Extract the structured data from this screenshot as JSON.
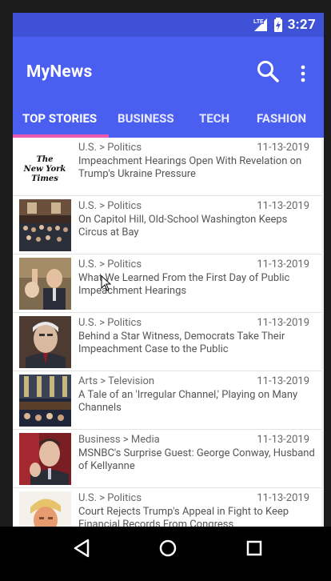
{
  "status_bar": {
    "network": "LTE",
    "time": "3:27"
  },
  "app": {
    "title": "MyNews"
  },
  "tabs": [
    {
      "label": "TOP STORIES",
      "active": true
    },
    {
      "label": "BUSINESS",
      "active": false
    },
    {
      "label": "TECH",
      "active": false
    },
    {
      "label": "FASHION",
      "active": false
    }
  ],
  "colors": {
    "status_bar": "#3f51d6",
    "app_bar": "#4a5ff0",
    "tab_indicator": "#e95ab0"
  },
  "articles": [
    {
      "section": "U.S. > Politics",
      "date": "11-13-2019",
      "title": "Impeachment Hearings Open With Revelation on Trump's Ukraine Pressure",
      "thumb": "nyt-logo",
      "thumb_text": "The New York Times"
    },
    {
      "section": "U.S. > Politics",
      "date": "11-13-2019",
      "title": "On Capitol Hill, Old-School Washington Keeps Circus at Bay",
      "thumb": "hearing-room-photo"
    },
    {
      "section": "U.S. > Politics",
      "date": "11-13-2019",
      "title": "What We Learned From the First Day of Public Impeachment Hearings",
      "thumb": "witness-sworn-photo"
    },
    {
      "section": "U.S. > Politics",
      "date": "11-13-2019",
      "title": "Behind a Star Witness, Democrats Take Their Impeachment Case to the Public",
      "thumb": "witness-portrait-photo"
    },
    {
      "section": "Arts > Television",
      "date": "11-13-2019",
      "title": "A Tale of an 'Irregular Channel,' Playing on Many Channels",
      "thumb": "committee-hall-photo"
    },
    {
      "section": "Business > Media",
      "date": "11-13-2019",
      "title": "MSNBC's Surprise Guest: George Conway, Husband of Kellyanne",
      "thumb": "guest-portrait-photo"
    },
    {
      "section": "U.S. > Politics",
      "date": "11-13-2019",
      "title": "Court Rejects Trump's Appeal in Fight to Keep Financial Records From Congress",
      "thumb": "president-portrait-photo"
    }
  ]
}
